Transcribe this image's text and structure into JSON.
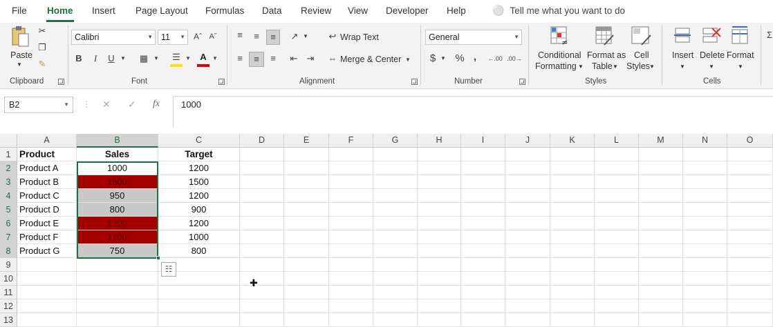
{
  "menu": {
    "items": [
      "File",
      "Home",
      "Insert",
      "Page Layout",
      "Formulas",
      "Data",
      "Review",
      "View",
      "Developer",
      "Help"
    ],
    "tell_me": "Tell me what you want to do"
  },
  "ribbon": {
    "clipboard": {
      "paste": "Paste",
      "label": "Clipboard"
    },
    "font": {
      "name": "Calibri",
      "size": "11",
      "bold": "B",
      "italic": "I",
      "underline": "U",
      "label": "Font"
    },
    "alignment": {
      "wrap_text": "Wrap Text",
      "merge_center": "Merge & Center",
      "label": "Alignment"
    },
    "number": {
      "format": "General",
      "currency": "$",
      "percent": "%",
      "comma": ",",
      "inc_dec": "←.00",
      "dec_dec": ".00→",
      "label": "Number"
    },
    "styles": {
      "conditional_1": "Conditional",
      "conditional_2": "Formatting",
      "format_table_1": "Format as",
      "format_table_2": "Table",
      "cell_styles_1": "Cell",
      "cell_styles_2": "Styles",
      "label": "Styles"
    },
    "cells": {
      "insert": "Insert",
      "delete": "Delete",
      "format": "Format",
      "label": "Cells"
    }
  },
  "formula_bar": {
    "name_box": "B2",
    "fx": "fx",
    "value": "1000"
  },
  "columns": [
    "A",
    "B",
    "C",
    "D",
    "E",
    "F",
    "G",
    "H",
    "I",
    "J",
    "K",
    "L",
    "M",
    "N",
    "O"
  ],
  "rows": [
    "1",
    "2",
    "3",
    "4",
    "5",
    "6",
    "7",
    "8",
    "9",
    "10",
    "11",
    "12",
    "13"
  ],
  "sheet": {
    "header": [
      "Product",
      "Sales",
      "Target"
    ],
    "data": [
      [
        "Product A",
        "1000",
        "1200"
      ],
      [
        "Product B",
        "1600",
        "1500"
      ],
      [
        "Product C",
        "950",
        "1200"
      ],
      [
        "Product D",
        "800",
        "900"
      ],
      [
        "Product E",
        "1300",
        "1200"
      ],
      [
        "Product F",
        "1100",
        "1000"
      ],
      [
        "Product G",
        "750",
        "800"
      ]
    ],
    "sales_fill": [
      "none",
      "red",
      "gray",
      "gray",
      "red",
      "red",
      "gray"
    ]
  },
  "colors": {
    "accent": "#1e7145",
    "red_fill": "#a50000",
    "gray_fill": "#c8c8c8"
  }
}
